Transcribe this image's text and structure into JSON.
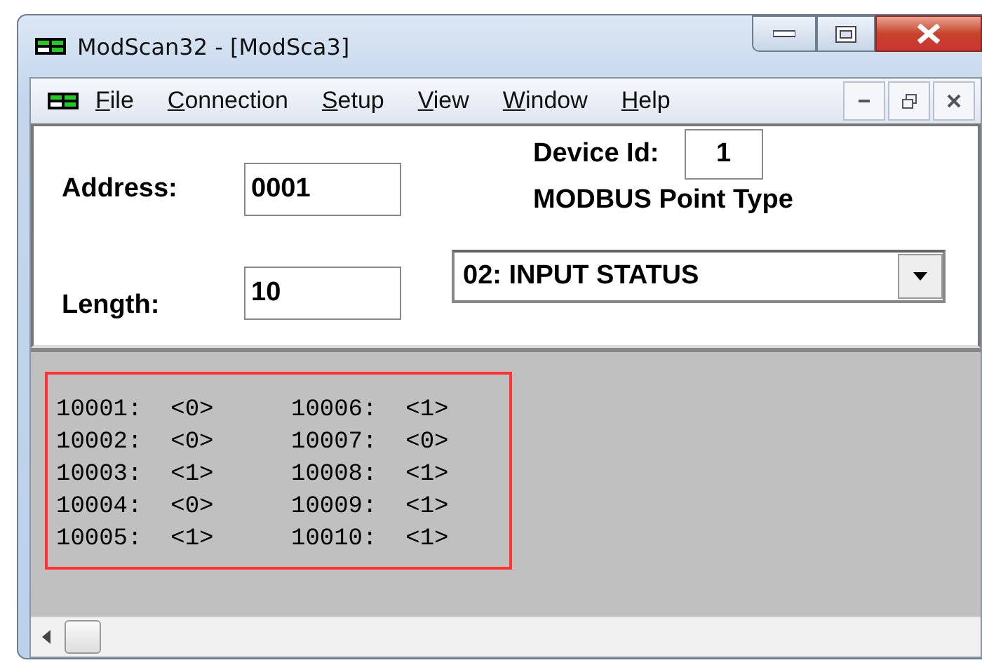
{
  "window": {
    "title": "ModScan32 - [ModSca3]"
  },
  "menu": [
    "File",
    "Connection",
    "Setup",
    "View",
    "Window",
    "Help"
  ],
  "form": {
    "address_label": "Address:",
    "address": "0001",
    "length_label": "Length:",
    "length": "10",
    "device_id_label": "Device Id:",
    "device_id": "1",
    "point_type_label": "MODBUS Point Type",
    "point_type": "02: INPUT STATUS"
  },
  "registers": [
    {
      "address": "10001:",
      "value": "<0>"
    },
    {
      "address": "10002:",
      "value": "<0>"
    },
    {
      "address": "10003:",
      "value": "<1>"
    },
    {
      "address": "10004:",
      "value": "<0>"
    },
    {
      "address": "10005:",
      "value": "<1>"
    },
    {
      "address": "10006:",
      "value": "<1>"
    },
    {
      "address": "10007:",
      "value": "<0>"
    },
    {
      "address": "10008:",
      "value": "<1>"
    },
    {
      "address": "10009:",
      "value": "<1>"
    },
    {
      "address": "10010:",
      "value": "<1>"
    }
  ]
}
